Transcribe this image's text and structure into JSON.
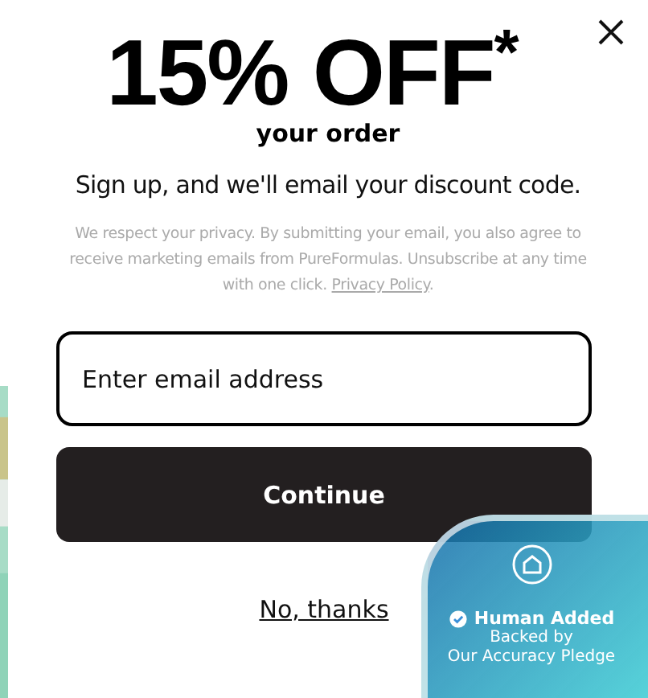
{
  "headline": "15% OFF$^{*}$",
  "subheadline": "your order",
  "tagline": "Sign up, and we'll email your discount code.",
  "disclaimer": {
    "text": "We respect your privacy. By submitting your email, you also agree to receive marketing emails from PureFormulas. Unsubscribe at any time with one click.",
    "link": "Privacy Policy",
    "end": "."
  },
  "email_field": {
    "placeholder": "Enter email address"
  },
  "submit_button": "Continue",
  "decline_link": "No, thanks",
  "badge": {
    "title": "Human Added",
    "line_1": "Backed by",
    "line_2": "Our Accuracy Pledge"
  }
}
